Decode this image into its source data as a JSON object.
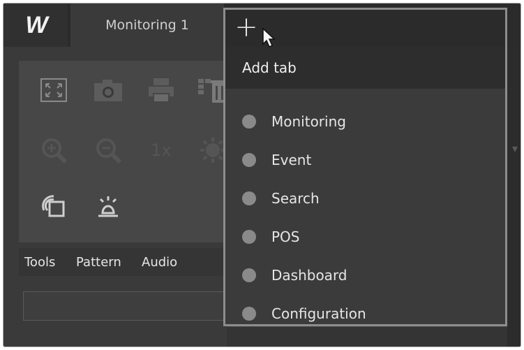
{
  "app": {
    "logo_text": "W",
    "active_tab": "Monitoring 1"
  },
  "add_tab_menu": {
    "header": "Add tab",
    "items": [
      {
        "label": "Monitoring"
      },
      {
        "label": "Event"
      },
      {
        "label": "Search"
      },
      {
        "label": "POS"
      },
      {
        "label": "Dashboard"
      },
      {
        "label": "Configuration"
      }
    ]
  },
  "toolbar": {
    "zoom_label": "1x",
    "icons": [
      "fullscreen-icon",
      "camera-icon",
      "print-icon",
      "grid-delete-icon",
      "zoom-in-icon",
      "zoom-out-icon",
      "zoom-1x-icon",
      "brightness-icon",
      "overlay-icon",
      "alarm-icon"
    ]
  },
  "panel_tabs": [
    "Tools",
    "Pattern",
    "Audio"
  ],
  "colors": {
    "background": "#3a3a3a",
    "menu_bg": "#3b3b3b",
    "menu_border": "#8d8d8d",
    "dot": "#8a8a8a"
  }
}
